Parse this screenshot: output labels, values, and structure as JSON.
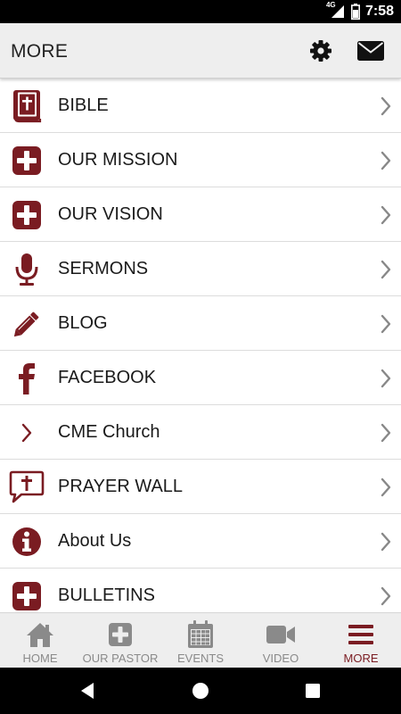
{
  "status_bar": {
    "network": "4G",
    "time": "7:58"
  },
  "header": {
    "title": "MORE",
    "settings_icon": "gear-icon",
    "mail_icon": "envelope-icon"
  },
  "menu": {
    "items": [
      {
        "label": "BIBLE",
        "icon": "bible-icon"
      },
      {
        "label": "OUR MISSION",
        "icon": "plus-box-icon"
      },
      {
        "label": "OUR VISION",
        "icon": "plus-box-icon"
      },
      {
        "label": "SERMONS",
        "icon": "microphone-icon"
      },
      {
        "label": "BLOG",
        "icon": "pencil-icon"
      },
      {
        "label": "FACEBOOK",
        "icon": "facebook-icon"
      },
      {
        "label": "CME Church",
        "icon": "chevron-right-icon"
      },
      {
        "label": "PRAYER WALL",
        "icon": "cross-speech-bubble-icon"
      },
      {
        "label": "About Us",
        "icon": "info-icon"
      },
      {
        "label": "BULLETINS",
        "icon": "plus-box-icon"
      }
    ]
  },
  "bottom_nav": {
    "items": [
      {
        "label": "HOME",
        "icon": "home-icon"
      },
      {
        "label": "OUR PASTOR",
        "icon": "plus-box-icon"
      },
      {
        "label": "EVENTS",
        "icon": "calendar-icon"
      },
      {
        "label": "VIDEO",
        "icon": "video-camera-icon"
      },
      {
        "label": "MORE",
        "icon": "menu-icon",
        "active": true
      }
    ]
  },
  "colors": {
    "accent": "#7a1c22",
    "inactive": "#8a8a8a",
    "header_bg": "#eeeeee"
  }
}
